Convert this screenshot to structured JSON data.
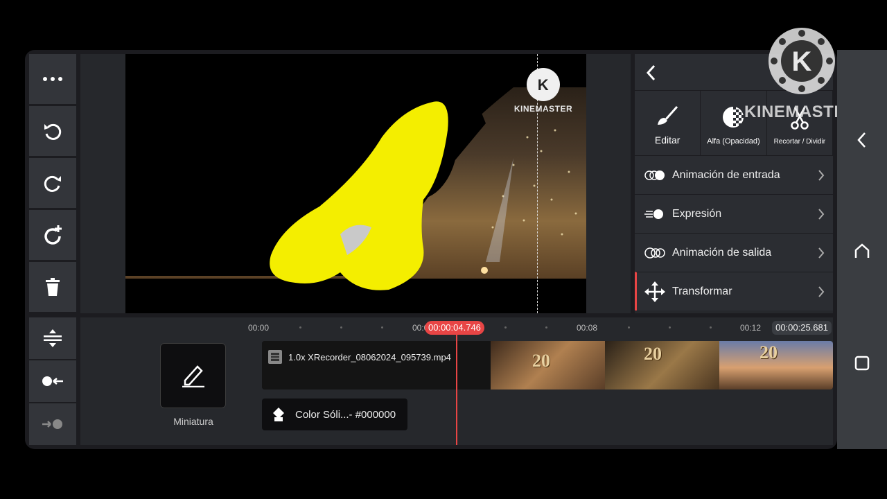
{
  "watermark": {
    "text": "KINEMASTER"
  },
  "toolbar": {
    "more_icon": "more-dots-icon",
    "undo_icon": "undo-icon",
    "redo_icon": "redo-icon",
    "restore_icon": "restore-icon",
    "delete_icon": "trash-icon",
    "fit_icon": "fit-height-icon",
    "record_icon": "record-icon",
    "record_next_icon": "record-next-icon"
  },
  "right_panel": {
    "back_icon": "chevron-left-icon",
    "tools": [
      {
        "label": "Editar",
        "icon": "brush-icon"
      },
      {
        "label": "Alfa (Opacidad)",
        "icon": "alpha-icon"
      },
      {
        "label": "Recortar / Dividir",
        "icon": "scissors-icon"
      }
    ],
    "items": [
      {
        "label": "Animación de entrada",
        "icon": "in-animation-icon"
      },
      {
        "label": "Expresión",
        "icon": "expression-icon"
      },
      {
        "label": "Animación de salida",
        "icon": "out-animation-icon"
      },
      {
        "label": "Transformar",
        "icon": "move-icon"
      }
    ]
  },
  "timeline": {
    "ruler": [
      "00:00",
      "00:04",
      "00:08",
      "00:12"
    ],
    "current_time": "00:00:04.746",
    "duration": "00:00:25.681",
    "thumbnail_label": "Miniatura",
    "clip_name": "1.0x XRecorder_08062024_095739.mp4",
    "layer_label": "Color Sóli...- #000000",
    "accent": "#e84545"
  },
  "navbar": {
    "back_icon": "nav-back-icon",
    "home_icon": "nav-home-icon",
    "recents_icon": "nav-recents-icon"
  }
}
